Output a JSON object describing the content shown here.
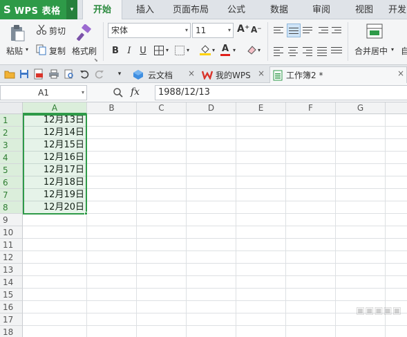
{
  "app": {
    "logo": "S",
    "title": "WPS 表格",
    "menu_arrow": "▾"
  },
  "menu": {
    "tabs": [
      {
        "label": "开始",
        "active": true
      },
      {
        "label": "插入"
      },
      {
        "label": "页面布局"
      },
      {
        "label": "公式"
      },
      {
        "label": "数据"
      },
      {
        "label": "审阅"
      },
      {
        "label": "视图"
      },
      {
        "label": "开发"
      }
    ]
  },
  "ribbon": {
    "paste_label": "粘贴",
    "cut_label": "剪切",
    "copy_label": "复制",
    "format_painter_label": "格式刷",
    "font_name": "宋体",
    "font_size": "11",
    "bold": "B",
    "italic": "I",
    "underline": "U",
    "font_color_glyph": "A",
    "grow_font": "A⁺",
    "shrink_font": "A⁻",
    "merge_label": "合并居中",
    "wrap_label": "自",
    "dropdown_arrow": "▾",
    "accent_color": "#2e9a48"
  },
  "quickbar": {
    "tabs": [
      {
        "label": "云文档",
        "icon": "cloud-doc-icon",
        "close": "×"
      },
      {
        "label": "我的WPS",
        "icon": "wps-logo-icon",
        "close": "×"
      },
      {
        "label": "工作簿2 *",
        "icon": "workbook-icon",
        "close": "×",
        "active": true
      }
    ]
  },
  "formula_bar": {
    "name_box": "A1",
    "fx": "fx",
    "value": "1988/12/13"
  },
  "sheet": {
    "columns": [
      "A",
      "B",
      "C",
      "D",
      "E",
      "F",
      "G"
    ],
    "rows": [
      "1",
      "2",
      "3",
      "4",
      "5",
      "6",
      "7",
      "8",
      "9",
      "10",
      "11",
      "12",
      "13",
      "14",
      "15",
      "16",
      "17",
      "18"
    ],
    "cells_A": [
      "12月13日",
      "12月14日",
      "12月15日",
      "12月16日",
      "12月17日",
      "12月18日",
      "12月19日",
      "12月20日"
    ],
    "selection_color": "#2e9a48"
  }
}
